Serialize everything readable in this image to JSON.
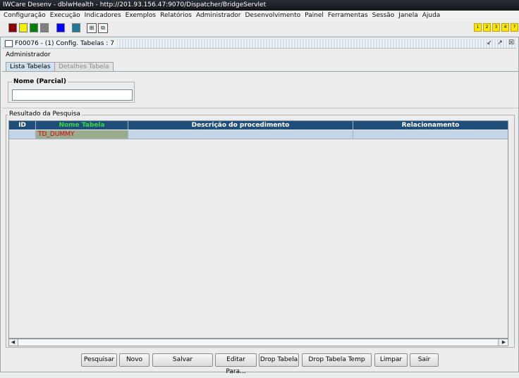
{
  "window": {
    "title": "IWCare Desenv - dblwHealth - http://201.93.156.47:9070/Dispatcher/BridgeServlet",
    "minimize": "–",
    "maximize": "□",
    "close": "✕"
  },
  "menu": [
    "Configuração",
    "Execução",
    "Indicadores",
    "Exemplos",
    "Relatórios",
    "Administrador",
    "Desenvolvimento",
    "Painel",
    "Ferramentas",
    "Sessão",
    "Janela",
    "Ajuda"
  ],
  "toolbar": {
    "swatches": [
      "#8b0000",
      "#f2f200",
      "#008000",
      "#808080",
      "#0000ff",
      "#1e7a9a"
    ],
    "icons": [
      "tree-icon",
      "windows-icon"
    ],
    "icon_glyphs": [
      "⊞",
      "⧉"
    ],
    "shortcuts": [
      "1",
      "2",
      "3",
      "4",
      "?"
    ]
  },
  "frame": {
    "title": "F00076 - (1) Config. Tabelas : 7",
    "breadcrumb": "Administrador",
    "buttons": [
      "↙",
      "↗",
      "☒"
    ]
  },
  "tabs": {
    "lista": "Lista Tabelas",
    "detalhes": "Detalhes Tabela"
  },
  "search": {
    "group_label": "Nome (Parcial)",
    "value": ""
  },
  "results": {
    "group_label": "Resultado da Pesquisa",
    "columns": [
      "ID",
      "Nome Tabela",
      "Descrição do procedimento",
      "Relacionamento"
    ],
    "rows": [
      {
        "id": "",
        "nome": "TD_DUMMY",
        "descricao": "",
        "relacionamento": ""
      }
    ]
  },
  "scroll": {
    "left": "◀",
    "right": "▶"
  },
  "buttons": {
    "pesquisar": "Pesquisar",
    "novo": "Novo",
    "salvar": "Salvar",
    "editar": "Editar Para...",
    "drop": "Drop Tabela",
    "drop_temp": "Drop Tabela Temp",
    "limpar": "Limpar",
    "sair": "Sair"
  }
}
